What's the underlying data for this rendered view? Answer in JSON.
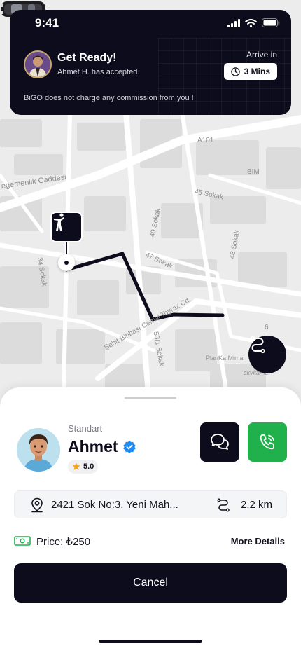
{
  "status_bar": {
    "time": "9:41"
  },
  "notification": {
    "title": "Get Ready!",
    "subtitle": "Ahmet H. has accepted.",
    "arrive_label": "Arrive in",
    "arrive_value": "3 Mins",
    "note": "BiGO does not charge any commission from you !"
  },
  "map": {
    "labels": {
      "caddesi": "egemenlik Caddesi",
      "a101": "A101",
      "bim": "BIM",
      "s45": "45 Sokak",
      "s40": "40 Sokak",
      "s47": "47 Sokak",
      "s34": "34 Sokak",
      "s48": "48 Sokak",
      "sehit": "Şehit Binbaşı Cemal Toyraz Cd.",
      "s53": "53/1 Sokak",
      "plankamimar": "PlanKa Mimar",
      "skykamel": "skykamel",
      "s6": "6"
    }
  },
  "driver": {
    "class": "Standart",
    "name": "Ahmet",
    "rating": "5.0"
  },
  "route": {
    "address": "2421 Sok No:3, Yeni Mah...",
    "distance": "2.2 km"
  },
  "price": {
    "label": "Price: ₺250"
  },
  "links": {
    "more_details": "More Details"
  },
  "actions": {
    "cancel": "Cancel"
  },
  "colors": {
    "dark": "#0d0c1d",
    "green": "#21b14c",
    "verified": "#1d8cf8",
    "star": "#f5a623"
  }
}
